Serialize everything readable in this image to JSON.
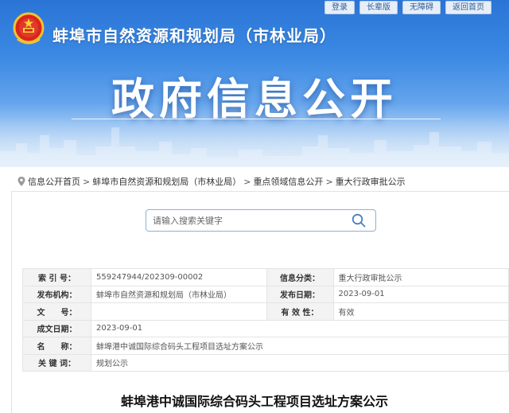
{
  "top_links": [
    "登录",
    "长辈版",
    "无障碍",
    "返回首页"
  ],
  "header": {
    "agency_name": "蚌埠市自然资源和规划局（市林业局）",
    "banner_title": "政府信息公开"
  },
  "breadcrumb": [
    "信息公开首页",
    "蚌埠市自然资源和规划局（市林业局）",
    "重点领域信息公开",
    "重大行政审批公示"
  ],
  "breadcrumb_separator": ">",
  "search": {
    "placeholder": "请输入搜索关键字",
    "value": ""
  },
  "meta": {
    "index_label": "索 引 号：",
    "index_value": "559247944/202309-00002",
    "category_label": "信息分类：",
    "category_value": "重大行政审批公示",
    "publisher_label": "发布机构：",
    "publisher_value": "蚌埠市自然资源和规划局（市林业局）",
    "pubdate_label": "发布日期：",
    "pubdate_value": "2023-09-01",
    "docno_label": "文　　号：",
    "docno_value": "",
    "validity_label": "有 效 性：",
    "validity_value": "有效",
    "createdate_label": "成文日期：",
    "createdate_value": "2023-09-01",
    "name_label": "名　　称：",
    "name_value": "蚌埠港中诚国际综合码头工程项目选址方案公示",
    "keywords_label": "关 键 词：",
    "keywords_value": "规划公示"
  },
  "document_title": "蚌埠港中诚国际综合码头工程项目选址方案公示",
  "colors": {
    "banner_blue": "#2a74d6",
    "search_border": "#8fb0d3",
    "label_bg": "#f3f3f3"
  },
  "icons": {
    "emblem": "national-emblem-icon",
    "location": "location-pin-icon",
    "search": "search-icon"
  }
}
